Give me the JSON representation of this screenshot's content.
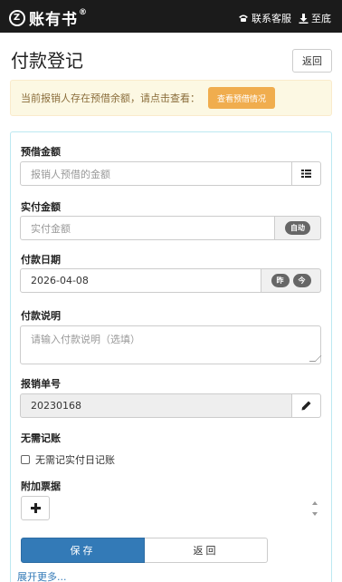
{
  "header": {
    "logo_mark": "Z",
    "logo_text": "账有书",
    "logo_reg": "®",
    "contact_label": "联系客服",
    "bottom_label": "至底"
  },
  "page": {
    "title": "付款登记",
    "back_label": "返回"
  },
  "notice": {
    "text": "当前报销人存在预借余额，请点击查看：",
    "button_label": "查看预借情况"
  },
  "form": {
    "advance_amount": {
      "label": "预借金额",
      "placeholder": "报销人预借的金额",
      "icon": "list-icon"
    },
    "actual_amount": {
      "label": "实付金额",
      "placeholder": "实付金额",
      "auto_label": "自动"
    },
    "payment_date": {
      "label": "付款日期",
      "value": "2026-04-08",
      "yesterday_label": "昨",
      "today_label": "今"
    },
    "description": {
      "label": "付款说明",
      "placeholder": "请输入付款说明（选填）"
    },
    "reimbursement_no": {
      "label": "报销单号",
      "value": "20230168",
      "icon": "pencil-icon"
    },
    "no_accounting": {
      "label": "无需记账",
      "checkbox_label": "无需记实付日记账",
      "checked": false
    },
    "attachments": {
      "label": "附加票据",
      "icon": "plus-icon"
    }
  },
  "actions": {
    "save_label": "保存",
    "back_label": "返回"
  },
  "footer": {
    "expand_label": "展开更多..."
  },
  "colors": {
    "topbar": "#1b1b1b",
    "primary": "#337ab7",
    "warning": "#f0ad4e",
    "notice_bg": "#fcf8e3"
  }
}
